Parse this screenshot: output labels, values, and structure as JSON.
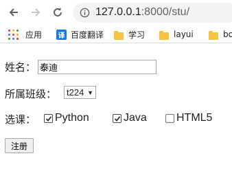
{
  "browser": {
    "url_host": "127.0.0.1",
    "url_rest": ":8000/stu/"
  },
  "bookmarks": {
    "apps_label": "应用",
    "translate_label": "百度翻译",
    "translate_icon_text": "译",
    "study_label": "学习",
    "layui_label": "layui",
    "boot_label": "boo"
  },
  "form": {
    "name_label": "姓名：",
    "name_value": "泰迪",
    "class_label": "所属班级：",
    "class_selected": "t224",
    "course_label": "选课：",
    "courses": [
      {
        "label": "Python",
        "checked": true
      },
      {
        "label": "Java",
        "checked": true
      },
      {
        "label": "HTML5",
        "checked": false
      }
    ],
    "submit_label": "注册"
  },
  "colors": {
    "accent": "#1a73e8",
    "folder": "#f6c342"
  }
}
